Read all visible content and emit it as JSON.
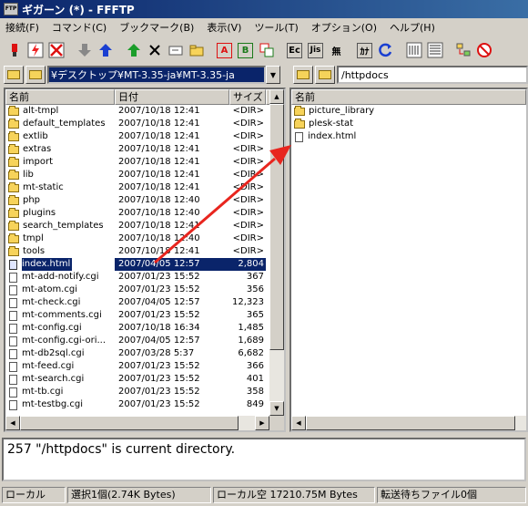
{
  "title": "ギガーン (*) - FFFTP",
  "menu": [
    "接続(F)",
    "コマンド(C)",
    "ブックマーク(B)",
    "表示(V)",
    "ツール(T)",
    "オプション(O)",
    "ヘルプ(H)"
  ],
  "toolbar": {
    "btn_ascii": "A",
    "btn_binary": "B",
    "btn_euc": "Ec",
    "btn_jis": "Jis",
    "btn_nokanji": "無",
    "btn_kana": "ｶﾅ"
  },
  "local": {
    "path": "¥デスクトップ¥MT-3.35-ja¥MT-3.35-ja",
    "columns": {
      "name": "名前",
      "date": "日付",
      "size": "サイズ"
    },
    "rows": [
      {
        "name": "alt-tmpl",
        "date": "2007/10/18 12:41",
        "size": "<DIR>",
        "type": "folder"
      },
      {
        "name": "default_templates",
        "date": "2007/10/18 12:41",
        "size": "<DIR>",
        "type": "folder"
      },
      {
        "name": "extlib",
        "date": "2007/10/18 12:41",
        "size": "<DIR>",
        "type": "folder"
      },
      {
        "name": "extras",
        "date": "2007/10/18 12:41",
        "size": "<DIR>",
        "type": "folder"
      },
      {
        "name": "import",
        "date": "2007/10/18 12:41",
        "size": "<DIR>",
        "type": "folder"
      },
      {
        "name": "lib",
        "date": "2007/10/18 12:41",
        "size": "<DIR>",
        "type": "folder"
      },
      {
        "name": "mt-static",
        "date": "2007/10/18 12:41",
        "size": "<DIR>",
        "type": "folder"
      },
      {
        "name": "php",
        "date": "2007/10/18 12:40",
        "size": "<DIR>",
        "type": "folder"
      },
      {
        "name": "plugins",
        "date": "2007/10/18 12:40",
        "size": "<DIR>",
        "type": "folder"
      },
      {
        "name": "search_templates",
        "date": "2007/10/18 12:41",
        "size": "<DIR>",
        "type": "folder"
      },
      {
        "name": "tmpl",
        "date": "2007/10/18 12:40",
        "size": "<DIR>",
        "type": "folder"
      },
      {
        "name": "tools",
        "date": "2007/10/18 12:41",
        "size": "<DIR>",
        "type": "folder"
      },
      {
        "name": "index.html",
        "date": "2007/04/05 12:57",
        "size": "2,804",
        "type": "file",
        "selected": true
      },
      {
        "name": "mt-add-notify.cgi",
        "date": "2007/01/23 15:52",
        "size": "367",
        "type": "file"
      },
      {
        "name": "mt-atom.cgi",
        "date": "2007/01/23 15:52",
        "size": "356",
        "type": "file"
      },
      {
        "name": "mt-check.cgi",
        "date": "2007/04/05 12:57",
        "size": "12,323",
        "type": "file"
      },
      {
        "name": "mt-comments.cgi",
        "date": "2007/01/23 15:52",
        "size": "365",
        "type": "file"
      },
      {
        "name": "mt-config.cgi",
        "date": "2007/10/18 16:34",
        "size": "1,485",
        "type": "file"
      },
      {
        "name": "mt-config.cgi-ori...",
        "date": "2007/04/05 12:57",
        "size": "1,689",
        "type": "file"
      },
      {
        "name": "mt-db2sql.cgi",
        "date": "2007/03/28  5:37",
        "size": "6,682",
        "type": "file"
      },
      {
        "name": "mt-feed.cgi",
        "date": "2007/01/23 15:52",
        "size": "366",
        "type": "file"
      },
      {
        "name": "mt-search.cgi",
        "date": "2007/01/23 15:52",
        "size": "401",
        "type": "file"
      },
      {
        "name": "mt-tb.cgi",
        "date": "2007/01/23 15:52",
        "size": "358",
        "type": "file"
      },
      {
        "name": "mt-testbg.cgi",
        "date": "2007/01/23 15:52",
        "size": "849",
        "type": "file"
      }
    ]
  },
  "remote": {
    "path": "/httpdocs",
    "columns": {
      "name": "名前"
    },
    "rows": [
      {
        "name": "picture_library",
        "type": "folder"
      },
      {
        "name": "plesk-stat",
        "type": "folder"
      },
      {
        "name": "index.html",
        "type": "file"
      }
    ]
  },
  "log": "257 \"/httpdocs\" is current directory.",
  "status": {
    "mode": "ローカル",
    "selection": "選択1個(2.74K Bytes)",
    "free": "ローカル空 17210.75M Bytes",
    "queue": "転送待ちファイル0個"
  },
  "colors": {
    "title_start": "#0a246a",
    "title_end": "#3a6ea5",
    "selection": "#0a246a",
    "arrow": "#e8251e"
  }
}
